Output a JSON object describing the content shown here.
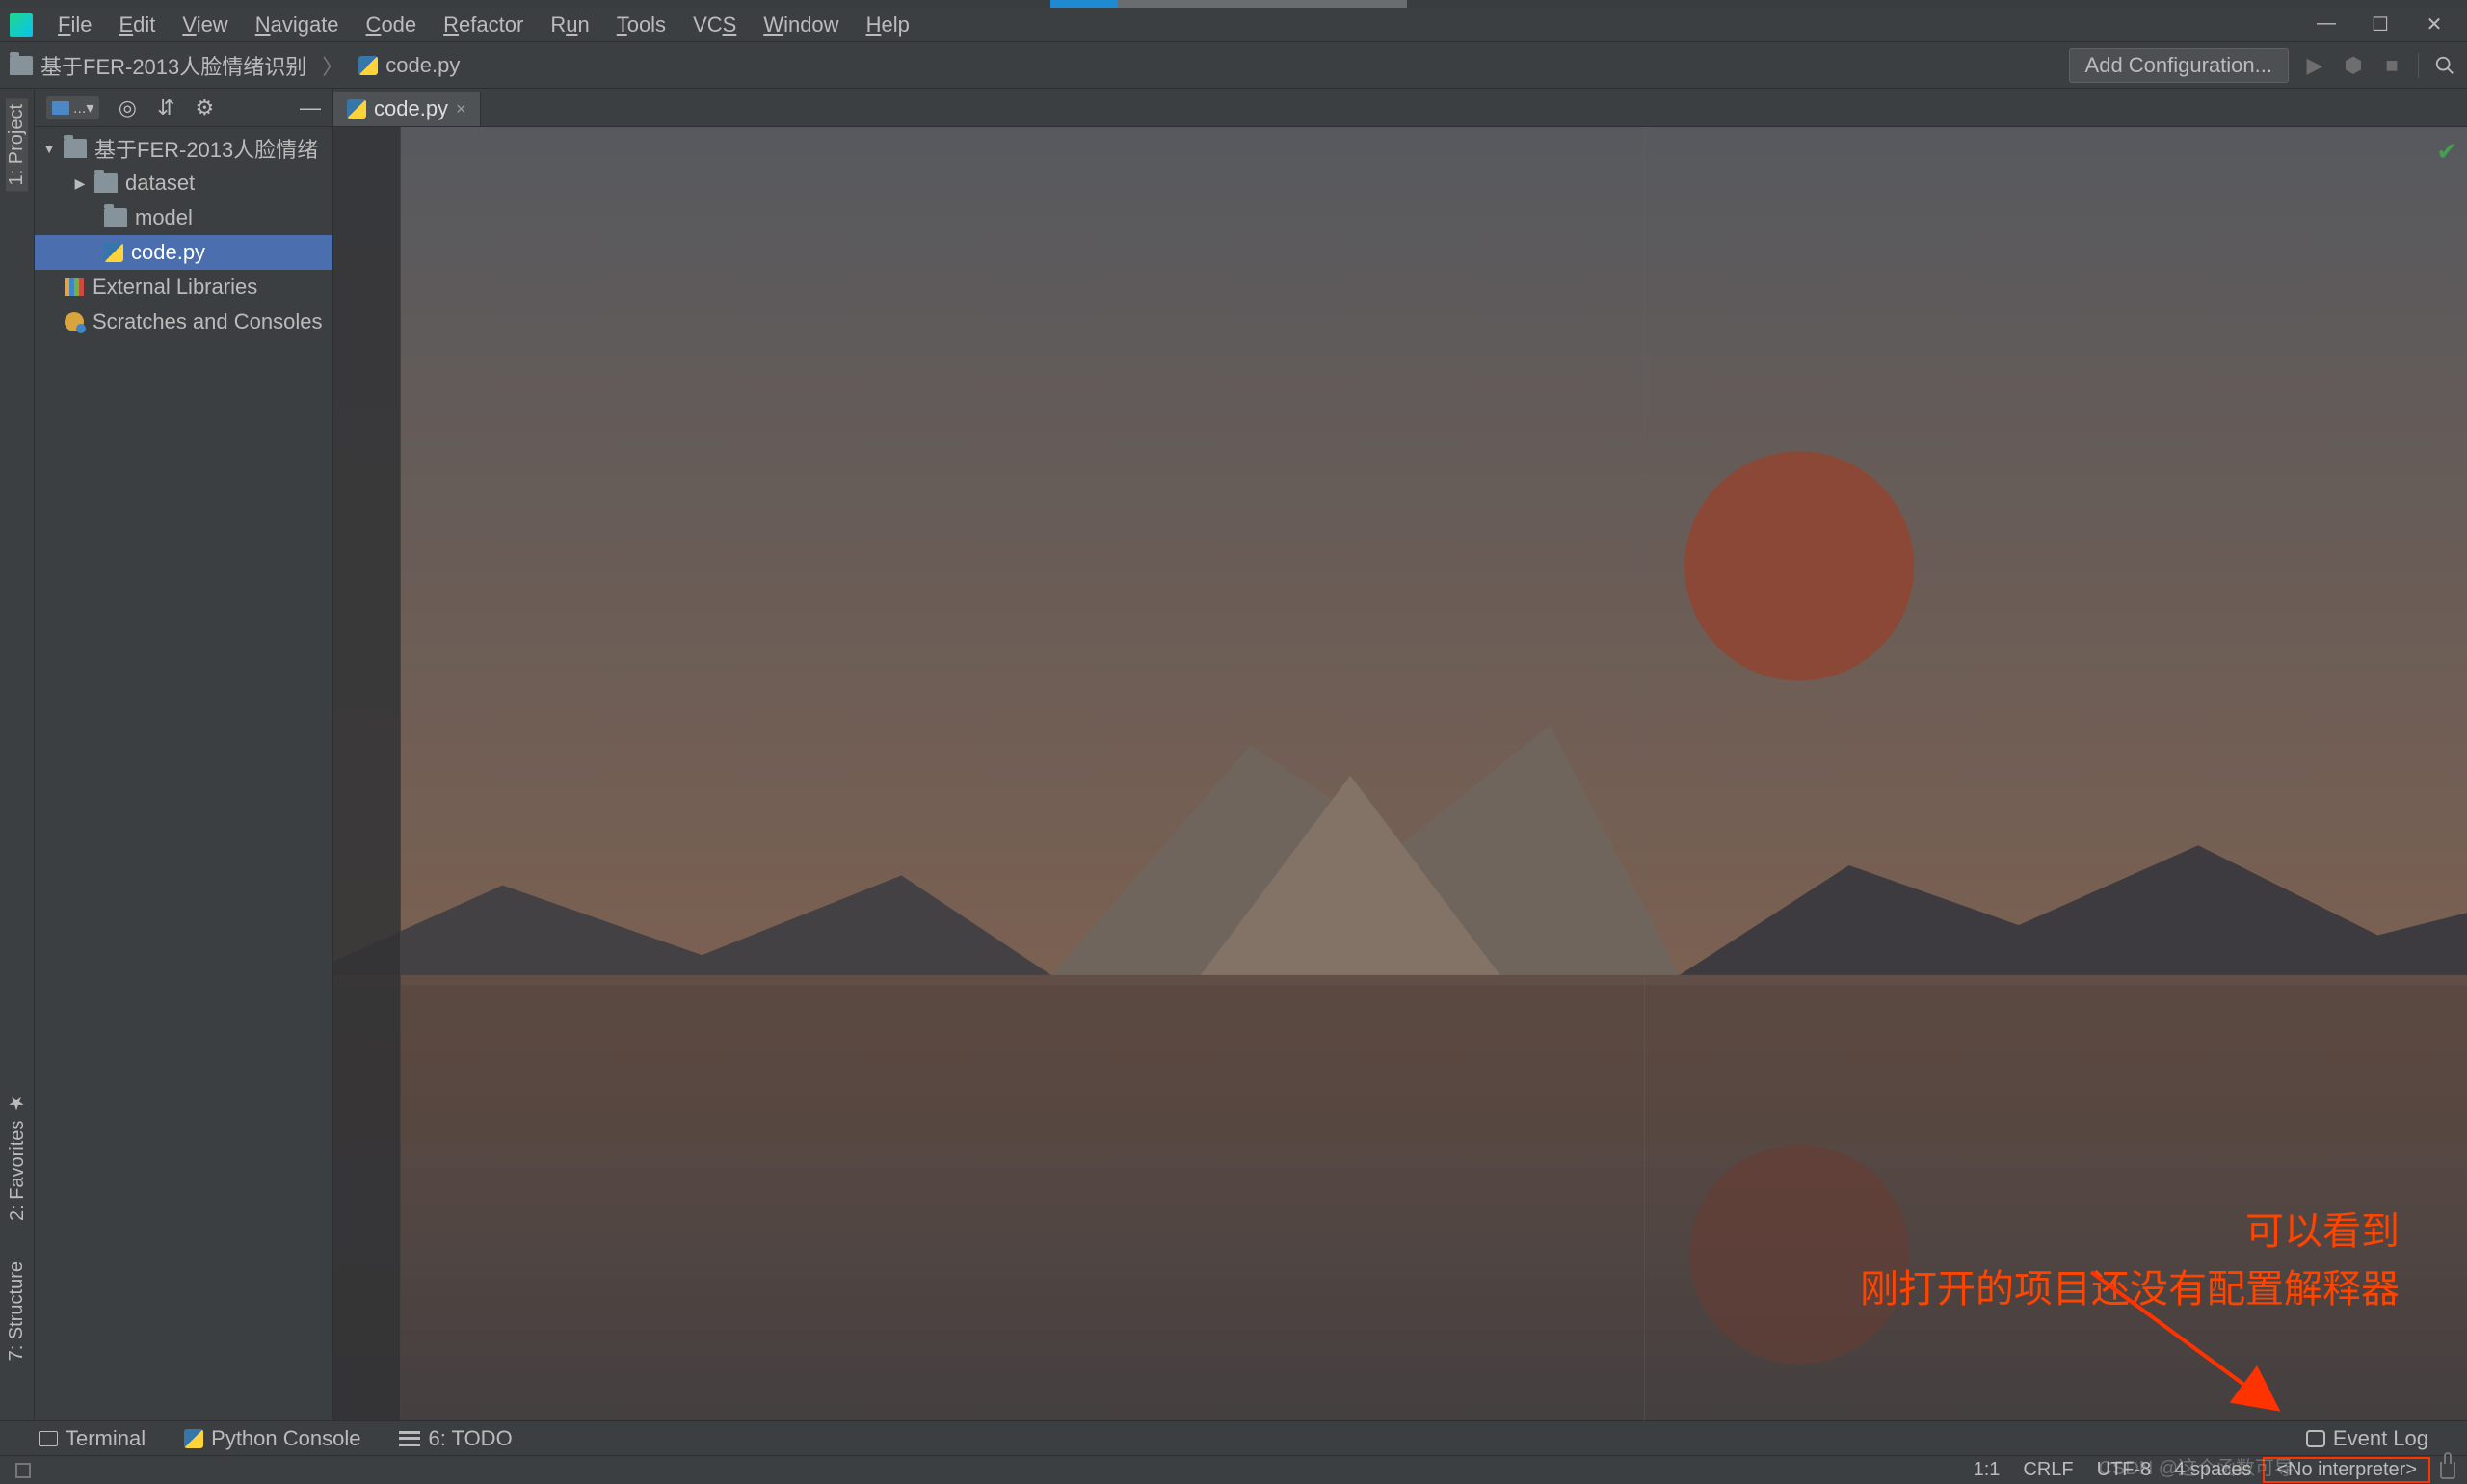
{
  "menu": {
    "items": [
      "File",
      "Edit",
      "View",
      "Navigate",
      "Code",
      "Refactor",
      "Run",
      "Tools",
      "VCS",
      "Window",
      "Help"
    ]
  },
  "breadcrumb": {
    "root": "基于FER-2013人脸情绪识别",
    "file": "code.py"
  },
  "toolbar": {
    "add_conf": "Add Configuration..."
  },
  "left_tabs": {
    "project": "1: Project",
    "favorites": "2: Favorites",
    "structure": "7: Structure"
  },
  "tree": {
    "root": "基于FER-2013人脸情绪",
    "dataset": "dataset",
    "model": "model",
    "code": "code.py",
    "ext": "External Libraries",
    "scratch": "Scratches and Consoles"
  },
  "tab": {
    "name": "code.py"
  },
  "bottom": {
    "terminal": "Terminal",
    "pyconsole": "Python Console",
    "todo": "6: TODO",
    "eventlog": "Event Log"
  },
  "status": {
    "pos": "1:1",
    "le": "CRLF",
    "enc": "UTF-8",
    "indent": "4 spaces",
    "interp": "<No interpreter>"
  },
  "annotation": {
    "l1": "可以看到",
    "l2": "刚打开的项目还没有配置解释器"
  },
  "watermark": "CSDN @这个函数可导"
}
